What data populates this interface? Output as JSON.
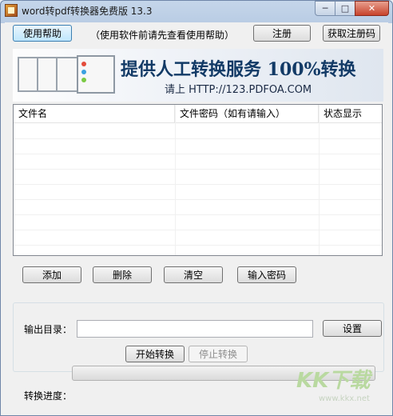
{
  "window": {
    "title": "word转pdf转换器免费版 13.3",
    "controls": {
      "minimize": "─",
      "maximize": "□",
      "close": "✕"
    }
  },
  "toolbar": {
    "help_button": "使用帮助",
    "help_hint": "（使用软件前请先查看使用帮助）",
    "register_button": "注册",
    "get_code_button": "获取注册码"
  },
  "banner": {
    "headline": "提供人工转换服务 100%转换",
    "subline": "请上   HTTP://123.PDFOA.COM"
  },
  "file_list": {
    "columns": [
      "文件名",
      "文件密码（如有请输入）",
      "状态显示"
    ],
    "rows": []
  },
  "actions": {
    "add": "添加",
    "delete": "删除",
    "clear": "清空",
    "password": "输入密码"
  },
  "output": {
    "dir_label": "输出目录：",
    "dir_value": "",
    "settings_button": "设置",
    "start_button": "开始转换",
    "stop_button": "停止转换"
  },
  "progress": {
    "label": "转换进度：",
    "value": 0
  },
  "watermark": {
    "text": "KK下载",
    "url": "www.kkx.net"
  }
}
